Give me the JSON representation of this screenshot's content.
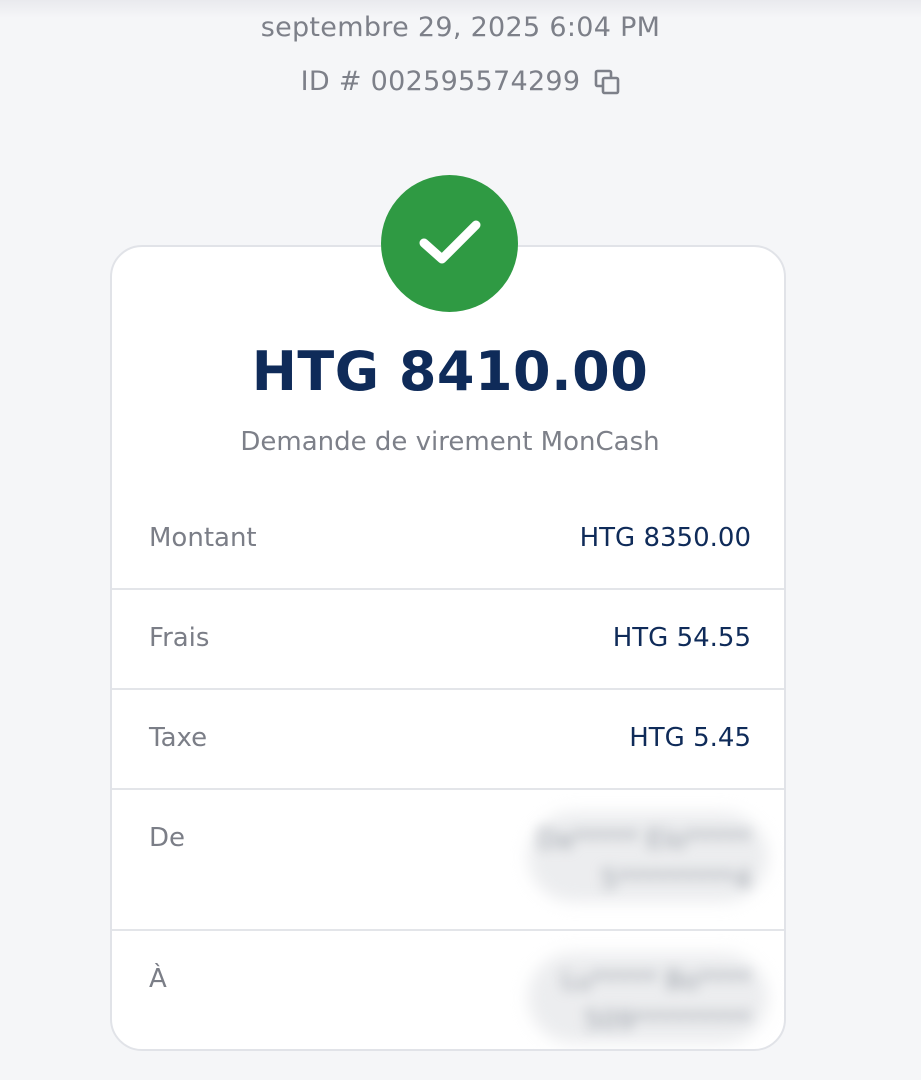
{
  "header": {
    "datetime": "septembre 29, 2025 6:04 PM",
    "id_label": "ID # 002595574299"
  },
  "receipt": {
    "status_icon": "checkmark-icon",
    "amount": "HTG 8410.00",
    "description": "Demande de virement MonCash",
    "rows": [
      {
        "label": "Montant",
        "value": "HTG 8350.00"
      },
      {
        "label": "Frais",
        "value": "HTG 54.55"
      },
      {
        "label": "Taxe",
        "value": "HTG 5.45"
      },
      {
        "label": "De",
        "value_line1": "Da***** Elo*****",
        "value_line2": "5*********4"
      },
      {
        "label": "À",
        "value_line1": "Lu***** Bo****",
        "value_line2": "509*********"
      }
    ]
  },
  "colors": {
    "success": "#2f9a43",
    "primary_text": "#0f2b59",
    "muted_text": "#7d8089",
    "background": "#f5f6f8"
  }
}
